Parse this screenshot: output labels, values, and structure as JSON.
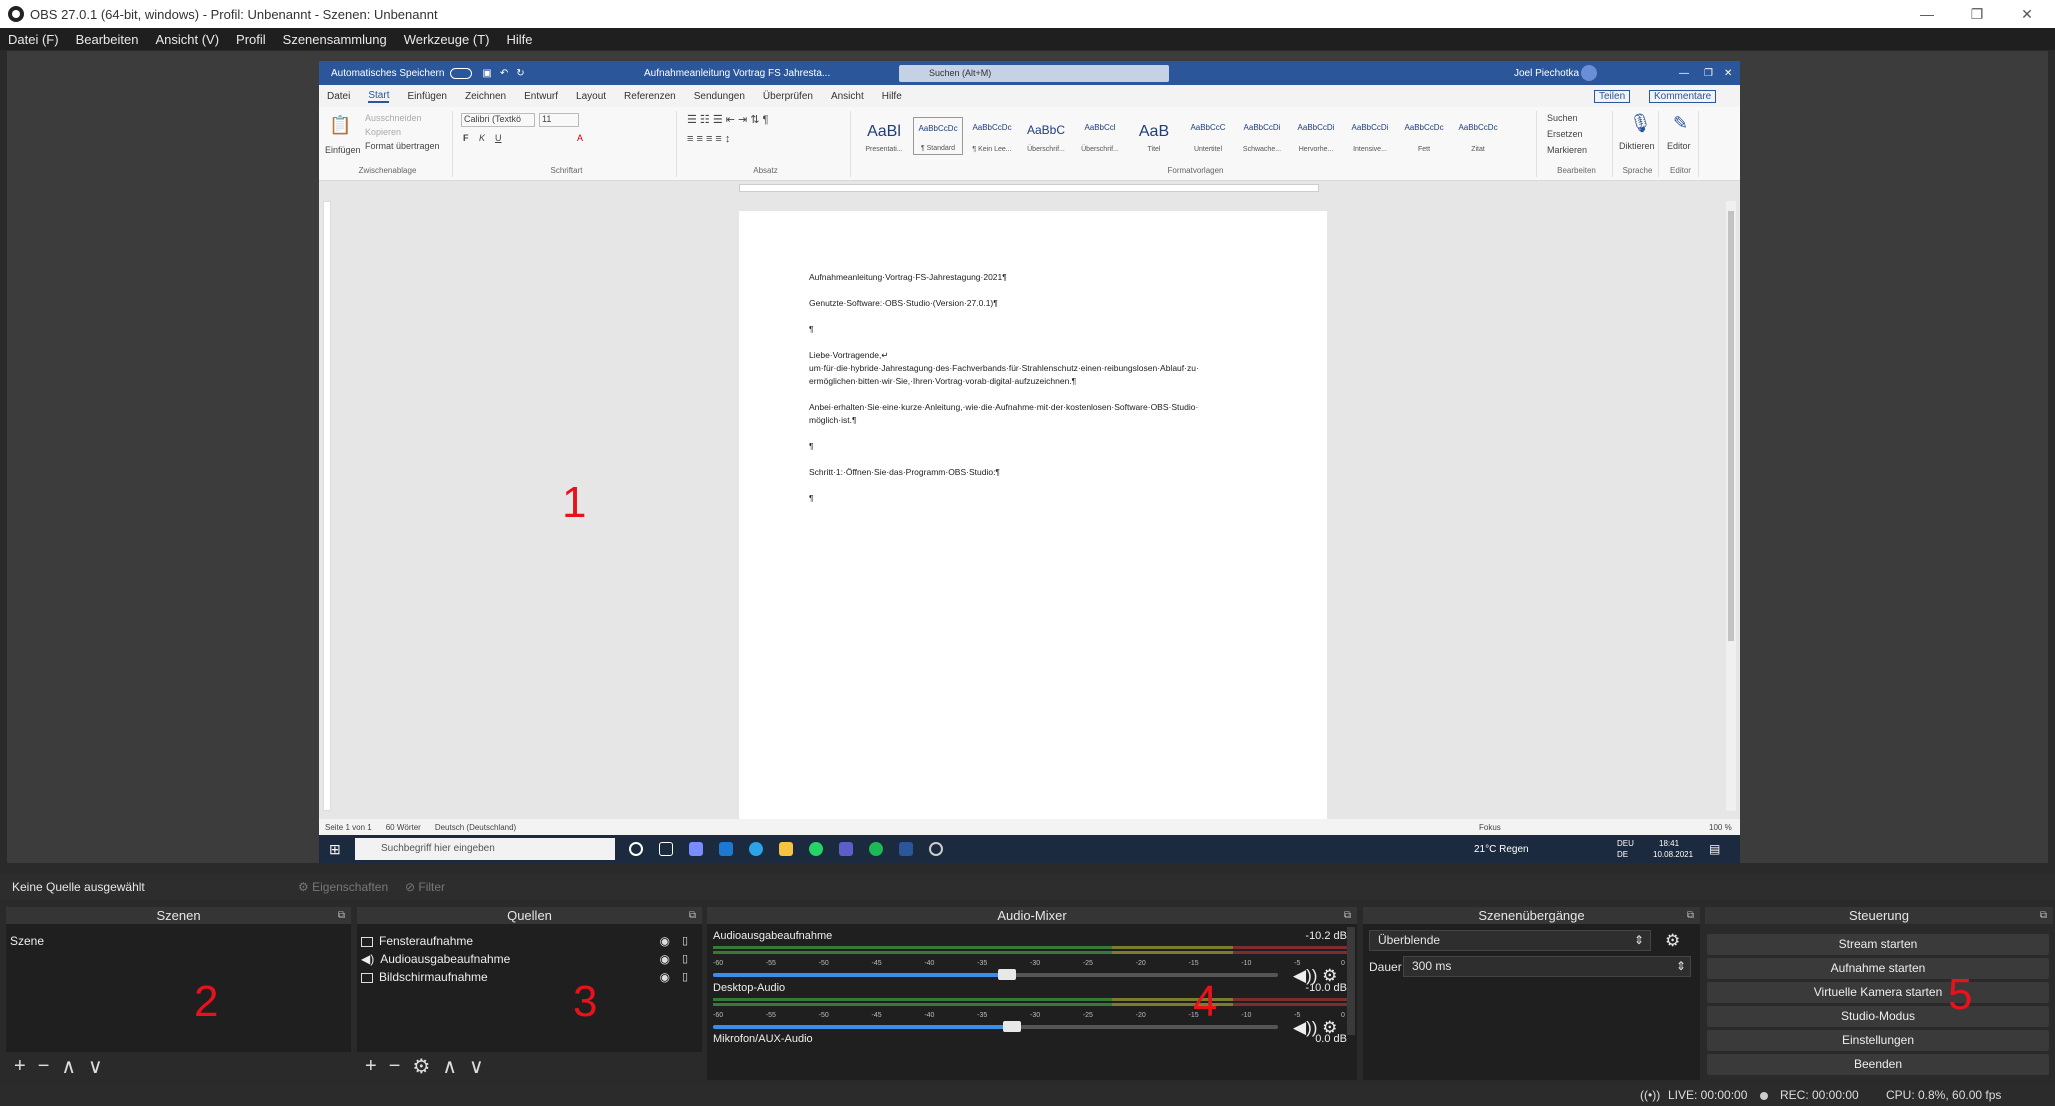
{
  "window": {
    "title": "OBS 27.0.1 (64-bit, windows) - Profil: Unbenannt - Szenen: Unbenannt"
  },
  "menu": [
    "Datei (F)",
    "Bearbeiten",
    "Ansicht (V)",
    "Profil",
    "Szenensammlung",
    "Werkzeuge (T)",
    "Hilfe"
  ],
  "annotations": {
    "n1": "1",
    "n2": "2",
    "n3": "3",
    "n4": "4",
    "n5": "5"
  },
  "word": {
    "autosave": "Automatisches Speichern",
    "doc_title": "Aufnahmeanleitung Vortrag FS Jahresta...",
    "search": "Suchen (Alt+M)",
    "user": "Joel Piechotka",
    "tabs": [
      "Datei",
      "Start",
      "Einfügen",
      "Zeichnen",
      "Entwurf",
      "Layout",
      "Referenzen",
      "Sendungen",
      "Überprüfen",
      "Ansicht",
      "Hilfe"
    ],
    "share": "Teilen",
    "comments": "Kommentare",
    "clipboard": {
      "paste": "Einfügen",
      "cut": "Ausschneiden",
      "copy": "Kopieren",
      "format": "Format übertragen",
      "label": "Zwischenablage"
    },
    "font": {
      "name": "Calibri (Textkö",
      "size": "11",
      "label": "Schriftart"
    },
    "paragraph_label": "Absatz",
    "styles_label": "Formatvorlagen",
    "styles": [
      {
        "preview": "AaBl",
        "name": "Presentati..."
      },
      {
        "preview": "AaBbCcDc",
        "name": "¶ Standard"
      },
      {
        "preview": "AaBbCcDc",
        "name": "¶ Kein Lee..."
      },
      {
        "preview": "AaBbC",
        "name": "Überschrif..."
      },
      {
        "preview": "AaBbCcl",
        "name": "Überschrif..."
      },
      {
        "preview": "AaB",
        "name": "Titel"
      },
      {
        "preview": "AaBbCcC",
        "name": "Untertitel"
      },
      {
        "preview": "AaBbCcDi",
        "name": "Schwache..."
      },
      {
        "preview": "AaBbCcDi",
        "name": "Hervorhe..."
      },
      {
        "preview": "AaBbCcDi",
        "name": "Intensive..."
      },
      {
        "preview": "AaBbCcDc",
        "name": "Fett"
      },
      {
        "preview": "AaBbCcDc",
        "name": "Zitat"
      }
    ],
    "edit": {
      "find": "Suchen",
      "replace": "Ersetzen",
      "select": "Markieren",
      "label": "Bearbeiten"
    },
    "dictate": "Diktieren",
    "editor": "Editor",
    "voice_label": "Sprache",
    "editor_label": "Editor",
    "lines": [
      "Aufnahmeanleitung·Vortrag·FS-Jahrestagung·2021¶",
      "Genutzte·Software:·OBS·Studio·(Version·27.0.1)¶",
      "¶",
      "Liebe·Vortragende,↵",
      "um·für·die·hybride·Jahrestagung·des·Fachverbands·für·Strahlenschutz·einen·reibungslosen·Ablauf·zu·",
      "ermöglichen·bitten·wir·Sie,·Ihren·Vortrag·vorab·digital·aufzuzeichnen.¶",
      "Anbei·erhalten·Sie·eine·kurze·Anleitung,·wie·die·Aufnahme·mit·der·kostenlosen·Software·OBS·Studio·",
      "möglich·ist.¶",
      "¶",
      "Schritt·1:·Öffnen·Sie·das·Programm·OBS·Studio:¶",
      "¶"
    ],
    "status": {
      "page": "Seite 1 von 1",
      "words": "60 Wörter",
      "lang": "Deutsch (Deutschland)",
      "focus": "Fokus",
      "zoom": "100 %"
    },
    "taskbar": {
      "search": "Suchbegriff hier eingeben",
      "weather": "21°C Regen",
      "lang": "DEU",
      "lang2": "DE",
      "time": "18:41",
      "date": "10.08.2021"
    }
  },
  "source_bar": {
    "none_selected": "Keine Quelle ausgewählt",
    "properties": "Eigenschaften",
    "filter": "Filter"
  },
  "docks": {
    "scenes": {
      "title": "Szenen",
      "items": [
        "Szene"
      ]
    },
    "sources": {
      "title": "Quellen",
      "items": [
        "Fensteraufnahme",
        "Audioausgabeaufnahme",
        "Bildschirmaufnahme"
      ]
    },
    "mixer": {
      "title": "Audio-Mixer",
      "ticks": [
        "-60",
        "-55",
        "-50",
        "-45",
        "-40",
        "-35",
        "-30",
        "-25",
        "-20",
        "-15",
        "-10",
        "-5",
        "0"
      ],
      "tracks": [
        {
          "name": "Audioausgabeaufnahme",
          "db": "-10.2 dB",
          "level": 0.52
        },
        {
          "name": "Desktop-Audio",
          "db": "-10.0 dB",
          "level": 0.53
        },
        {
          "name": "Mikrofon/AUX-Audio",
          "db": "0.0 dB",
          "level": 1.0
        }
      ]
    },
    "transitions": {
      "title": "Szenenübergänge",
      "value": "Überblende",
      "duration_label": "Dauer",
      "duration": "300 ms"
    },
    "controls": {
      "title": "Steuerung",
      "buttons": [
        "Stream starten",
        "Aufnahme starten",
        "Virtuelle Kamera starten",
        "Studio-Modus",
        "Einstellungen",
        "Beenden"
      ]
    }
  },
  "status": {
    "live": "LIVE: 00:00:00",
    "rec": "REC: 00:00:00",
    "cpu": "CPU: 0.8%, 60.00 fps"
  },
  "colors": {
    "accent": "#e8121c",
    "word_blue": "#2b579a",
    "meter_green": "#4cc24c",
    "meter_yellow": "#c8c83a",
    "meter_red": "#c83a3a"
  }
}
